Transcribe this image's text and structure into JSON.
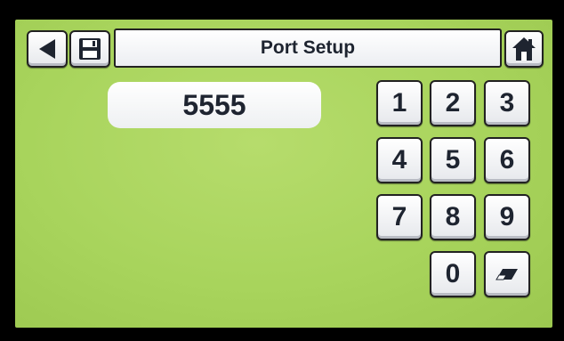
{
  "header": {
    "title": "Port Setup",
    "back_icon": "back-arrow-icon",
    "save_icon": "floppy-disk-icon",
    "home_icon": "home-icon"
  },
  "entry": {
    "value": "5555"
  },
  "keypad": {
    "k1": "1",
    "k2": "2",
    "k3": "3",
    "k4": "4",
    "k5": "5",
    "k6": "6",
    "k7": "7",
    "k8": "8",
    "k9": "9",
    "k0": "0",
    "erase_icon": "eraser-icon"
  },
  "colors": {
    "background": "#a8d45c",
    "key_face": "#ffffff",
    "text": "#1e2430"
  }
}
